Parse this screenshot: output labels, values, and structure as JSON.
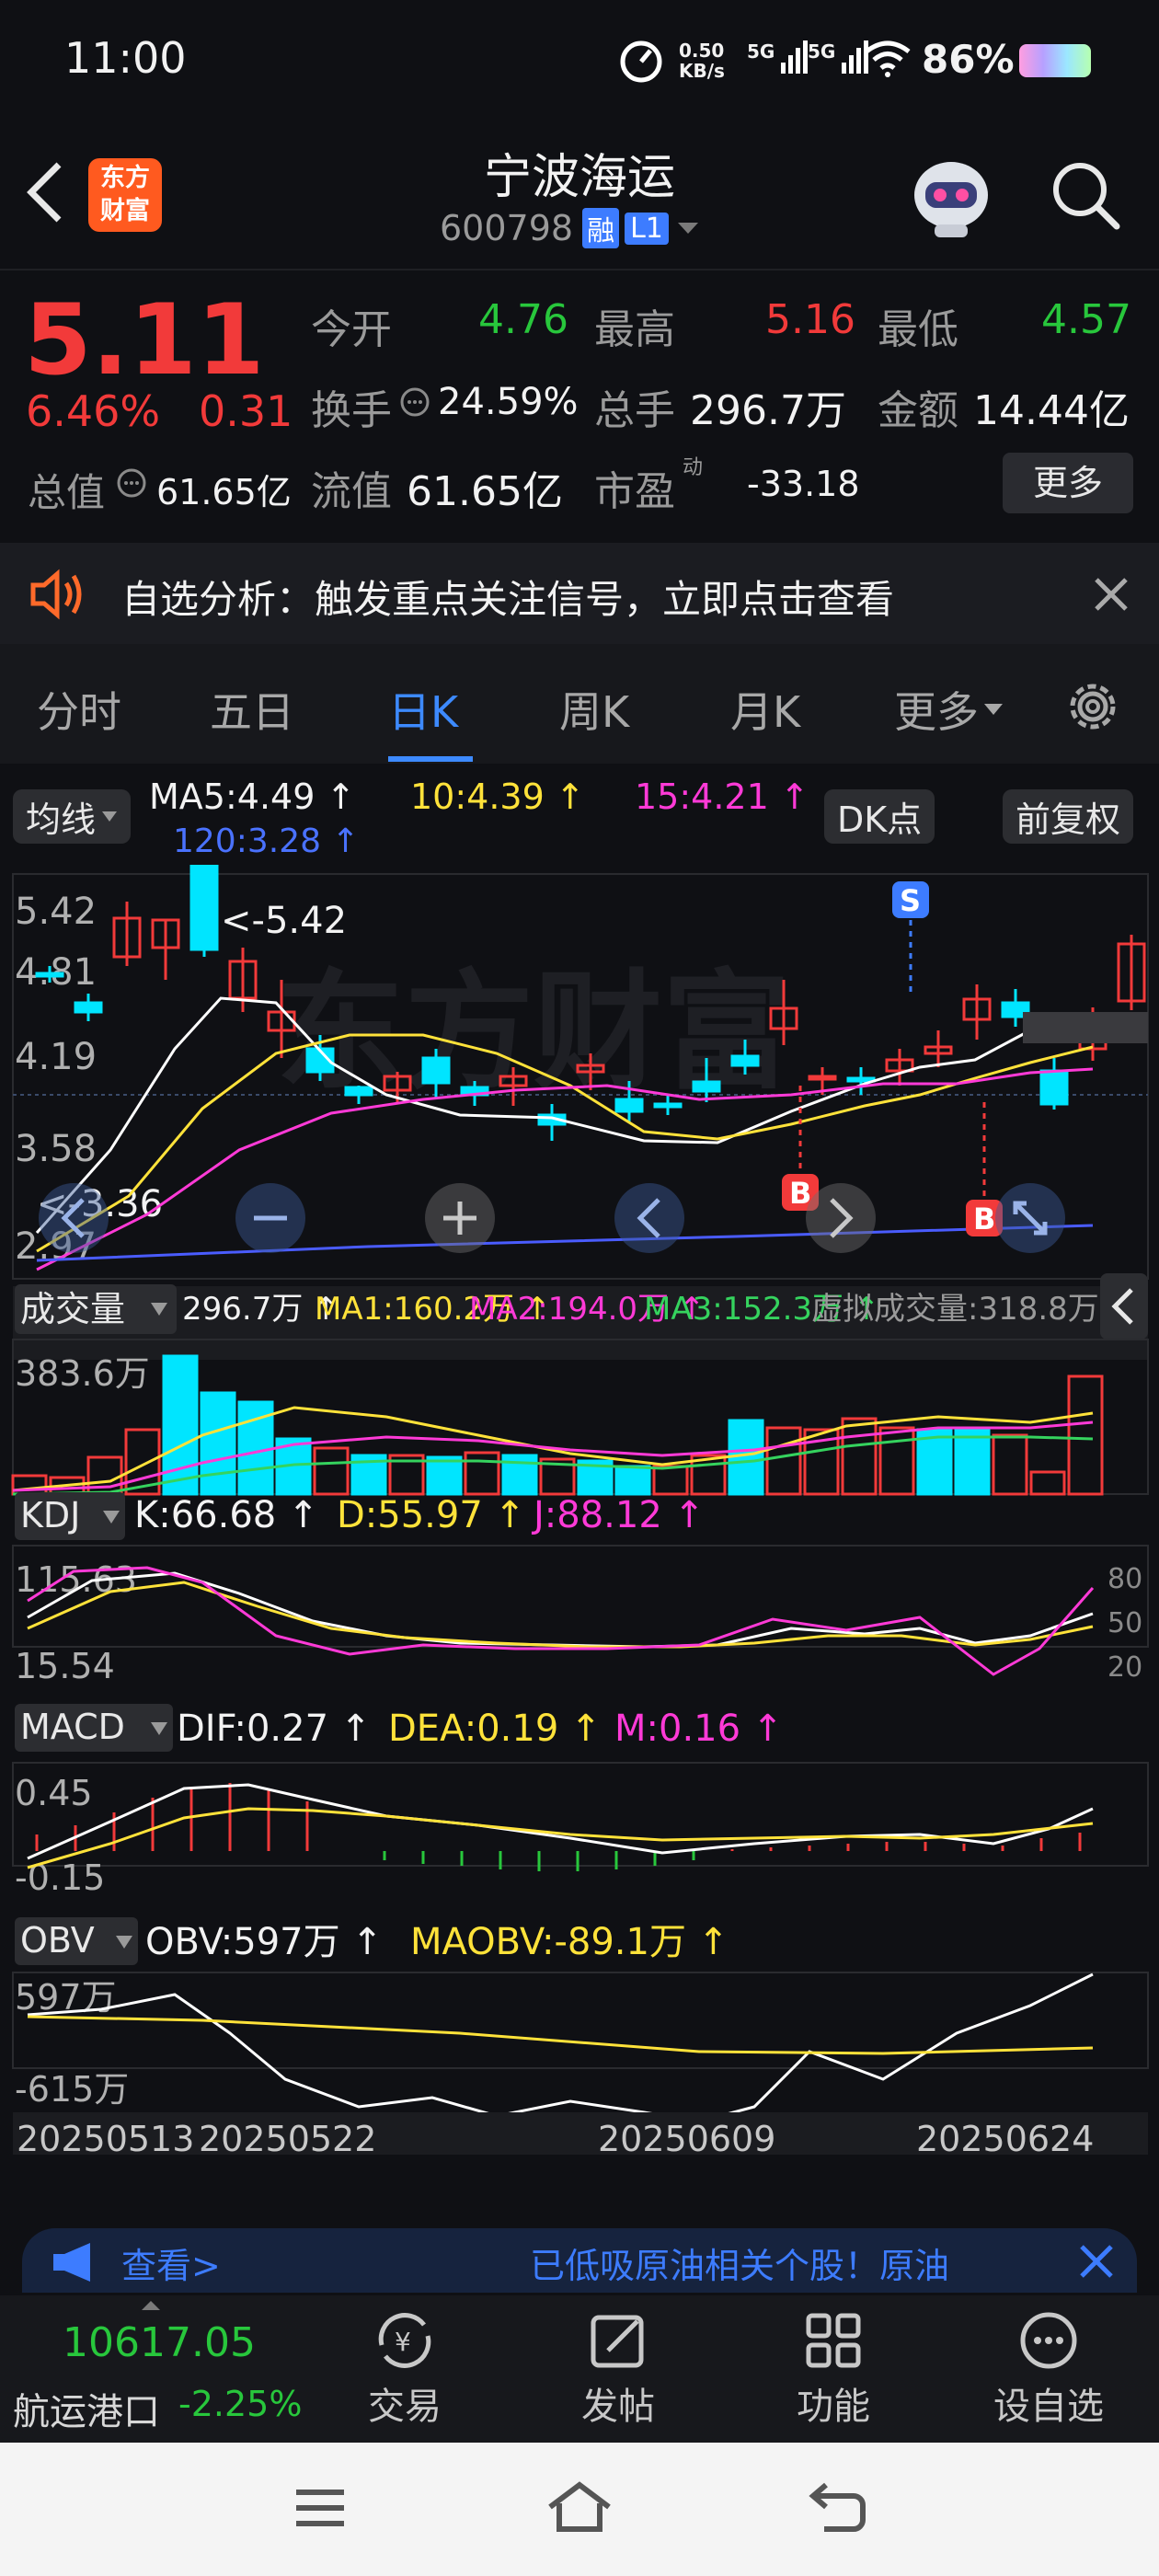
{
  "status_bar": {
    "time": "11:00",
    "speed_value": "0.50",
    "speed_unit": "KB/s",
    "net1": "5G",
    "net2": "5G",
    "battery": "86%"
  },
  "header": {
    "brand_line1": "东方",
    "brand_line2": "财富",
    "title": "宁波海运",
    "code": "600798",
    "badge_rong": "融",
    "badge_level": "L1"
  },
  "quote": {
    "price": "5.11",
    "change_pct": "6.46%",
    "change_amt": "0.31",
    "open_label": "今开",
    "open_value": "4.76",
    "high_label": "最高",
    "high_value": "5.16",
    "low_label": "最低",
    "low_value": "4.57",
    "turnover_label": "换手",
    "turnover_value": "24.59%",
    "volume_label": "总手",
    "volume_value": "296.7万",
    "amount_label": "金额",
    "amount_value": "14.44亿",
    "total_cap_label": "总值",
    "total_cap_value": "61.65亿",
    "float_cap_label": "流值",
    "float_cap_value": "61.65亿",
    "pe_label": "市盈",
    "pe_sup": "动",
    "pe_value": "-33.18",
    "more_button": "更多"
  },
  "banner": {
    "text": "自选分析：触发重点关注信号，立即点击查看"
  },
  "tabs": [
    {
      "label": "分时",
      "active": false
    },
    {
      "label": "五日",
      "active": false
    },
    {
      "label": "日K",
      "active": true
    },
    {
      "label": "周K",
      "active": false
    },
    {
      "label": "月K",
      "active": false
    },
    {
      "label": "更多",
      "active": false
    }
  ],
  "kline": {
    "ma_button": "均线",
    "ma5": "MA5:4.49 ↑",
    "ma10": "10:4.39 ↑",
    "ma15": "15:4.21 ↑",
    "ma120": "120:3.28 ↑",
    "dk_button": "DK点",
    "fq_button": "前复权",
    "y_labels": [
      "5.42",
      "4.81",
      "4.19",
      "3.58",
      "2.97"
    ],
    "max_note": "<-5.42",
    "min_note": "<-3.36",
    "signal_s": "S",
    "signal_b": "B"
  },
  "volume": {
    "button": "成交量",
    "vol": "296.7万 ↑",
    "ma1": "MA1:160.2万 ↑",
    "ma2": "MA2:194.0万 ↑",
    "ma3": "MA3:152.3万 ↑",
    "virtual": "虚拟成交量:318.8万",
    "y_max": "383.6万"
  },
  "kdj": {
    "button": "KDJ",
    "k": "K:66.68 ↑",
    "d": "D:55.97 ↑",
    "j": "J:88.12 ↑",
    "y_top": "115.63",
    "y_bottom": "15.54",
    "levels": [
      "80",
      "50",
      "20"
    ]
  },
  "macd": {
    "button": "MACD",
    "dif": "DIF:0.27 ↑",
    "dea": "DEA:0.19 ↑",
    "m": "M:0.16 ↑",
    "y_top": "0.45",
    "y_bottom": "-0.15"
  },
  "obv": {
    "button": "OBV",
    "obv": "OBV:597万 ↑",
    "maobv": "MAOBV:-89.1万 ↑",
    "y_top": "597万",
    "y_bottom": "-615万"
  },
  "dates": [
    "20250513",
    "20250522",
    "20250609",
    "20250624"
  ],
  "promo": {
    "left": "查看>",
    "right": "已低吸原油相关个股！原油"
  },
  "bottom_nav": {
    "index_value": "10617.05",
    "index_name": "航运港口",
    "index_change": "-2.25%",
    "items": [
      "交易",
      "发帖",
      "功能",
      "设自选"
    ]
  },
  "colors": {
    "up": "#f23a3a",
    "down": "#00e5ff",
    "ma5": "#ffffff",
    "ma10": "#ffe23a",
    "ma15": "#ff3ad7",
    "ma120": "#4a5cff",
    "accent": "#3d8aff"
  }
}
